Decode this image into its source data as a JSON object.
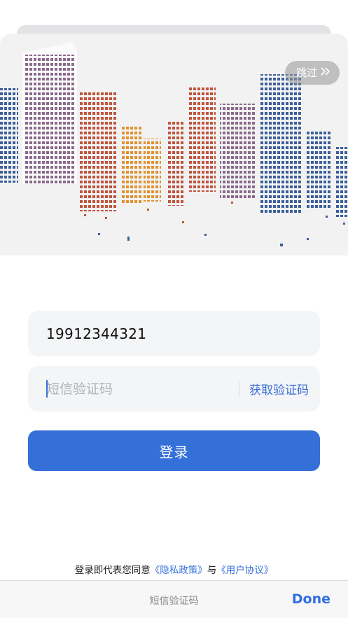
{
  "header": {
    "skip_label": "跳过",
    "skip_icon": "double-chevron-right-icon"
  },
  "form": {
    "phone_value": "19912344321",
    "code_placeholder": "短信验证码",
    "get_code_label": "获取验证码",
    "login_label": "登录"
  },
  "agreement": {
    "prefix": "登录即代表您同意",
    "privacy_link": "《隐私政策》",
    "joiner": "与",
    "user_link": "《用户协议》"
  },
  "keyboard_bar": {
    "field_title": "短信验证码",
    "done_label": "Done"
  },
  "colors": {
    "accent": "#3570d9",
    "link": "#3b6fd8",
    "field_bg": "#f4f5f7"
  }
}
